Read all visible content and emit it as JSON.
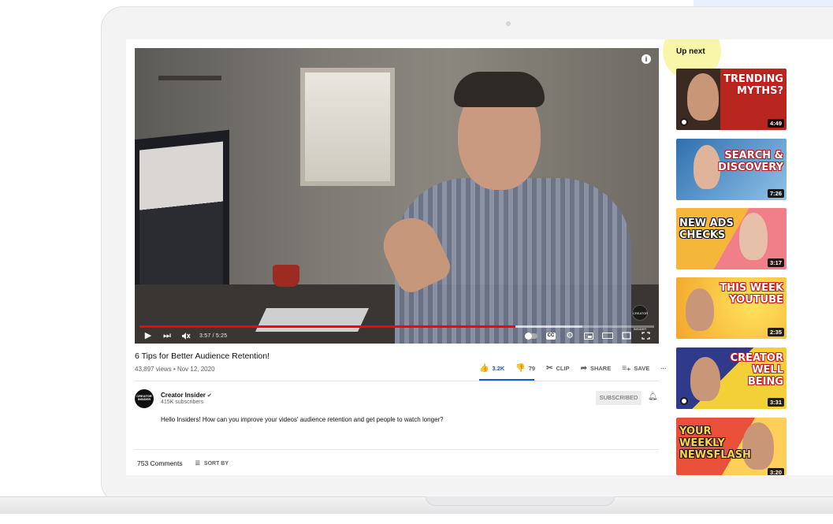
{
  "player": {
    "time_display": "3:57 / 5:25",
    "progress_fraction": 0.73,
    "buffered_fraction": 0.86,
    "watermark": "CREATOR INSIDER"
  },
  "video": {
    "title": "6 Tips for Better Audience Retention!",
    "meta": "43,897 views • Nov 12, 2020",
    "likes": "3.2K",
    "dislikes": "79",
    "clip_label": "CLIP",
    "share_label": "SHARE",
    "save_label": "SAVE",
    "more_label": "···"
  },
  "channel": {
    "avatar_text": "CREATOR INSIDER",
    "name": "Creator Insider",
    "verified": "✔",
    "subscribers": "415K subscribers",
    "subscribe_label": "SUBSCRIBED",
    "description": "Hello Insiders! How can you improve your videos' audience retention and get people to watch longer?"
  },
  "comments": {
    "count_label": "753 Comments",
    "sort_label": "SORT BY"
  },
  "up_next": {
    "heading": "Up next",
    "items": [
      {
        "title_art": "TRENDING MYTHS?",
        "duration": "4:49",
        "bg": "#a1261f"
      },
      {
        "title_art": "SEARCH & DISCOVERY",
        "duration": "7:26",
        "bg": "#3e7dbb"
      },
      {
        "title_art": "NEW ADS CHECKS",
        "duration": "3:17",
        "bg": "#f4b73a"
      },
      {
        "title_art": "THIS WEEK YOUTUBE",
        "duration": "2:35",
        "bg": "#f6d243"
      },
      {
        "title_art": "CREATOR WELL BEING",
        "duration": "3:31",
        "bg": "#3b3f8f"
      },
      {
        "title_art": "YOUR WEEKLY NEWSFLASH",
        "duration": "3:20",
        "bg": "#e9503a"
      }
    ]
  },
  "colors": {
    "accent": "#065fd4",
    "progress": "#ff0000",
    "highlight": "#f7f59a"
  }
}
